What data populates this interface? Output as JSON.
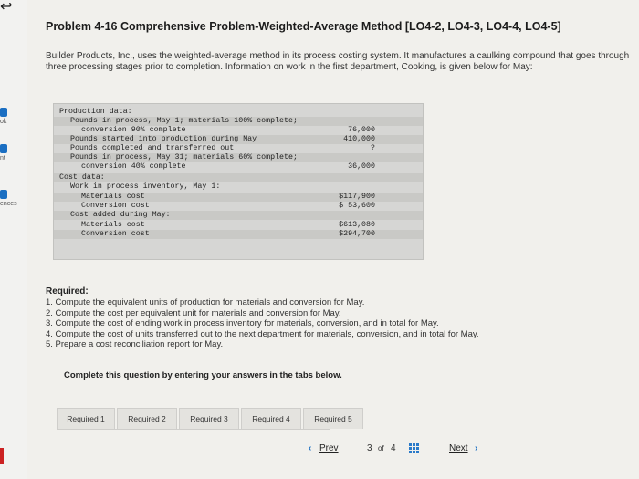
{
  "sidebar": {
    "items": [
      {
        "label": "ok"
      },
      {
        "label": "nt"
      },
      {
        "label": "ences"
      }
    ]
  },
  "problem": {
    "title": "Problem 4-16 Comprehensive Problem-Weighted-Average Method [LO4-2, LO4-3, LO4-4, LO4-5]",
    "intro": "Builder Products, Inc., uses the weighted-average method in its process costing system. It manufactures a caulking compound that goes through three processing stages prior to completion. Information on work in the first department, Cooking, is given below for May:"
  },
  "data_table": {
    "rows": [
      {
        "label": "Production data:",
        "value": ""
      },
      {
        "label": "Pounds in process, May 1; materials 100% complete;",
        "value": ""
      },
      {
        "label": "conversion 90% complete",
        "value": "76,000"
      },
      {
        "label": "Pounds started into production during May",
        "value": "410,000"
      },
      {
        "label": "Pounds completed and transferred out",
        "value": "?"
      },
      {
        "label": "Pounds in process, May 31; materials 60% complete;",
        "value": ""
      },
      {
        "label": "conversion 40% complete",
        "value": "36,000"
      },
      {
        "label": "Cost data:",
        "value": ""
      },
      {
        "label": "Work in process inventory, May 1:",
        "value": ""
      },
      {
        "label": "Materials cost",
        "value": "$117,900"
      },
      {
        "label": "Conversion cost",
        "value": "$ 53,600"
      },
      {
        "label": "Cost added during May:",
        "value": ""
      },
      {
        "label": "Materials cost",
        "value": "$613,080"
      },
      {
        "label": "Conversion cost",
        "value": "$294,700"
      }
    ]
  },
  "required": {
    "heading": "Required:",
    "items": [
      "1. Compute the equivalent units of production for materials and conversion for May.",
      "2. Compute the cost per equivalent unit for materials and conversion for May.",
      "3. Compute the cost of ending work in process inventory for materials, conversion, and in total for May.",
      "4. Compute the cost of units transferred out to the next department for materials, conversion, and in total for May.",
      "5. Prepare a cost reconciliation report for May."
    ]
  },
  "instruction": "Complete this question by entering your answers in the tabs below.",
  "tabs": [
    {
      "label": "Required 1"
    },
    {
      "label": "Required 2"
    },
    {
      "label": "Required 3"
    },
    {
      "label": "Required 4"
    },
    {
      "label": "Required 5"
    }
  ],
  "pager": {
    "prev": "Prev",
    "current": "3",
    "of": "of",
    "total": "4",
    "next": "Next"
  },
  "colors": {
    "accent": "#1b6fc2",
    "page_bg": "#f1f0ec",
    "data_box_bg": "#d6d6d4"
  }
}
